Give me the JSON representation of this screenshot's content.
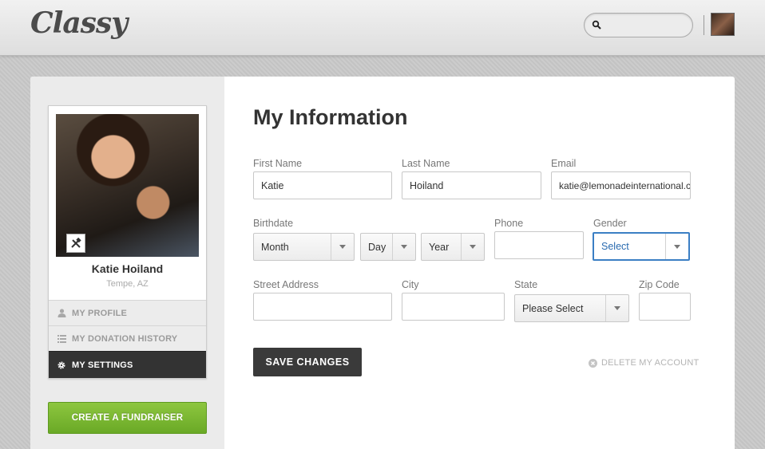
{
  "app": {
    "logo_text": "Classy"
  },
  "header": {
    "search_placeholder": ""
  },
  "profile": {
    "name": "Katie Hoiland",
    "location": "Tempe, AZ"
  },
  "nav": [
    {
      "label": "MY PROFILE",
      "icon": "user-icon",
      "active": false
    },
    {
      "label": "MY DONATION HISTORY",
      "icon": "list-icon",
      "active": false
    },
    {
      "label": "MY SETTINGS",
      "icon": "gear-icon",
      "active": true
    }
  ],
  "create_button": "CREATE A FUNDRAISER",
  "form": {
    "title": "My Information",
    "first_name": {
      "label": "First Name",
      "value": "Katie"
    },
    "last_name": {
      "label": "Last Name",
      "value": "Hoiland"
    },
    "email": {
      "label": "Email",
      "value": "katie@lemonadeinternational.c"
    },
    "birthdate": {
      "label": "Birthdate",
      "month": "Month",
      "day": "Day",
      "year": "Year"
    },
    "phone": {
      "label": "Phone",
      "value": ""
    },
    "gender": {
      "label": "Gender",
      "value": "Select"
    },
    "street": {
      "label": "Street Address",
      "value": ""
    },
    "city": {
      "label": "City",
      "value": ""
    },
    "state": {
      "label": "State",
      "value": "Please Select"
    },
    "zip": {
      "label": "Zip Code",
      "value": ""
    },
    "save_label": "SAVE CHANGES",
    "delete_label": "DELETE MY ACCOUNT"
  },
  "colors": {
    "accent_green": "#7ab833",
    "focus_blue": "#3b7fc4",
    "dark": "#333333"
  }
}
